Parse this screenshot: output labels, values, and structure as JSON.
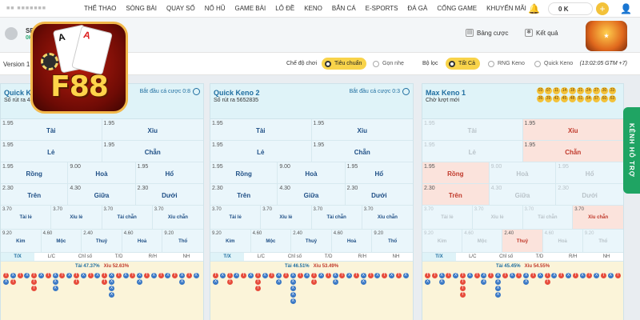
{
  "nav": {
    "items": [
      "THỂ THAO",
      "SÒNG BÀI",
      "QUAY SỐ",
      "NỔ HŨ",
      "GAME BÀI",
      "LÔ ĐỀ",
      "KENO",
      "BẮN CÁ",
      "E-SPORTS",
      "ĐÁ GÀ",
      "CỔNG GAME",
      "KHUYẾN MÃI"
    ],
    "balance": "0 K",
    "plus": "+"
  },
  "user": {
    "name": "SEOT",
    "balance": "0K"
  },
  "links": {
    "bet_table": "Bảng cược",
    "results": "Kết quả"
  },
  "filters": {
    "version": "Version 1",
    "mode_label": "Chế độ chơi",
    "mode_options": [
      "Tiêu chuẩn",
      "Gọn nhẹ"
    ],
    "filter_label": "Bộ lọc",
    "filter_options": [
      "Tất Cả",
      "RNG Keno",
      "Quick Keno"
    ],
    "time": "(13:02:05 GTM +7)"
  },
  "logo_text": "F88",
  "support": "KÊNH HỖ TRỢ",
  "tabs": [
    "T/X",
    "L/C",
    "Chỉ số",
    "T/D",
    "R/H",
    "NH"
  ],
  "panels": [
    {
      "title": "Quick Keno 1",
      "sub": "Số rút ra 4652",
      "start": "Bắt đầu cá cược 0:8",
      "odds": {
        "tai": "1.95",
        "xiu": "1.95",
        "le": "1.95",
        "chan": "1.95",
        "rong": "1.95",
        "hoa": "9.00",
        "ho": "1.95",
        "tren": "2.30",
        "giua": "4.30",
        "duoi": "2.30",
        "s1": "3.70",
        "s2": "3.70",
        "s3": "3.70",
        "s4": "3.70",
        "kim": "9.20",
        "moc": "4.60",
        "thuy": "2.40",
        "hoa2": "4.60",
        "tho": "9.20"
      },
      "stat": {
        "tai": "Tài",
        "tai_pct": "47.37%",
        "xiu": "Xỉu",
        "xiu_pct": "52.63%"
      }
    },
    {
      "title": "Quick Keno 2",
      "sub": "Số rút ra 5652835",
      "start": "Bắt đầu cá cược 0:3",
      "odds": {
        "tai": "1.95",
        "xiu": "1.95",
        "le": "1.95",
        "chan": "1.95",
        "rong": "1.95",
        "hoa": "9.00",
        "ho": "1.95",
        "tren": "2.30",
        "giua": "4.30",
        "duoi": "2.30",
        "s1": "3.70",
        "s2": "3.70",
        "s3": "3.70",
        "s4": "3.70",
        "kim": "9.20",
        "moc": "4.60",
        "thuy": "2.40",
        "hoa2": "4.60",
        "tho": "9.20"
      },
      "stat": {
        "tai": "Tài",
        "tai_pct": "46.51%",
        "xiu": "Xỉu",
        "xiu_pct": "53.49%"
      }
    },
    {
      "title": "Max Keno 1",
      "sub": "Chờ lượt mới",
      "start": "",
      "odds": {
        "tai": "1.95",
        "xiu": "1.95",
        "le": "1.95",
        "chan": "1.95",
        "rong": "1.95",
        "hoa": "9.00",
        "ho": "1.95",
        "tren": "2.30",
        "giua": "4.30",
        "duoi": "2.30",
        "s1": "3.70",
        "s2": "3.70",
        "s3": "3.70",
        "s4": "3.70",
        "kim": "9.20",
        "moc": "4.60",
        "thuy": "2.40",
        "hoa2": "4.60",
        "tho": "9.20"
      },
      "stat": {
        "tai": "Tài",
        "tai_pct": "45.45%",
        "xiu": "Xỉu",
        "xiu_pct": "54.55%"
      }
    }
  ],
  "labels": {
    "tai": "Tài",
    "xiu": "Xỉu",
    "le": "Lẻ",
    "chan": "Chẵn",
    "rong": "Rồng",
    "hoa": "Hoà",
    "ho": "Hổ",
    "tren": "Trên",
    "giua": "Giữa",
    "duoi": "Dưới",
    "s1": "Tài lẻ",
    "s2": "Xỉu lẻ",
    "s3": "Tài chẵn",
    "s4": "Xỉu chẵn",
    "kim": "Kim",
    "moc": "Mộc",
    "thuy": "Thuỷ",
    "hoa2": "Hoả",
    "tho": "Thổ"
  },
  "draw_balls": [
    "03",
    "07",
    "11",
    "14",
    "18",
    "21",
    "24",
    "27",
    "30",
    "33",
    "36",
    "39",
    "42",
    "45",
    "48",
    "51",
    "54",
    "57",
    "60",
    "63"
  ],
  "roads": [
    [
      "TX",
      "XT",
      "T",
      "X",
      "TTT",
      "X",
      "T",
      "XXX",
      "T",
      "X",
      "TT",
      "X",
      "T",
      "X",
      "TT",
      "XXXX",
      "T",
      "X",
      "T",
      "XX",
      "T",
      "X",
      "T",
      "X",
      "T",
      "XX",
      "T",
      "X"
    ],
    [
      "TX",
      "X",
      "TT",
      "X",
      "T",
      "X",
      "TTT",
      "X",
      "T",
      "XX",
      "T",
      "XXXXX",
      "T",
      "X",
      "TT",
      "X",
      "T",
      "XX",
      "T",
      "X",
      "T",
      "XX",
      "T",
      "X",
      "T",
      "X",
      "T",
      "X"
    ],
    [
      "TX",
      "T",
      "XX",
      "T",
      "X",
      "TTTT",
      "X",
      "T",
      "XX",
      "T",
      "XXXX",
      "T",
      "X",
      "T",
      "XX",
      "T",
      "X",
      "TT",
      "X",
      "T",
      "X",
      "T",
      "X",
      "T",
      "X",
      "T",
      "X",
      "T"
    ]
  ]
}
